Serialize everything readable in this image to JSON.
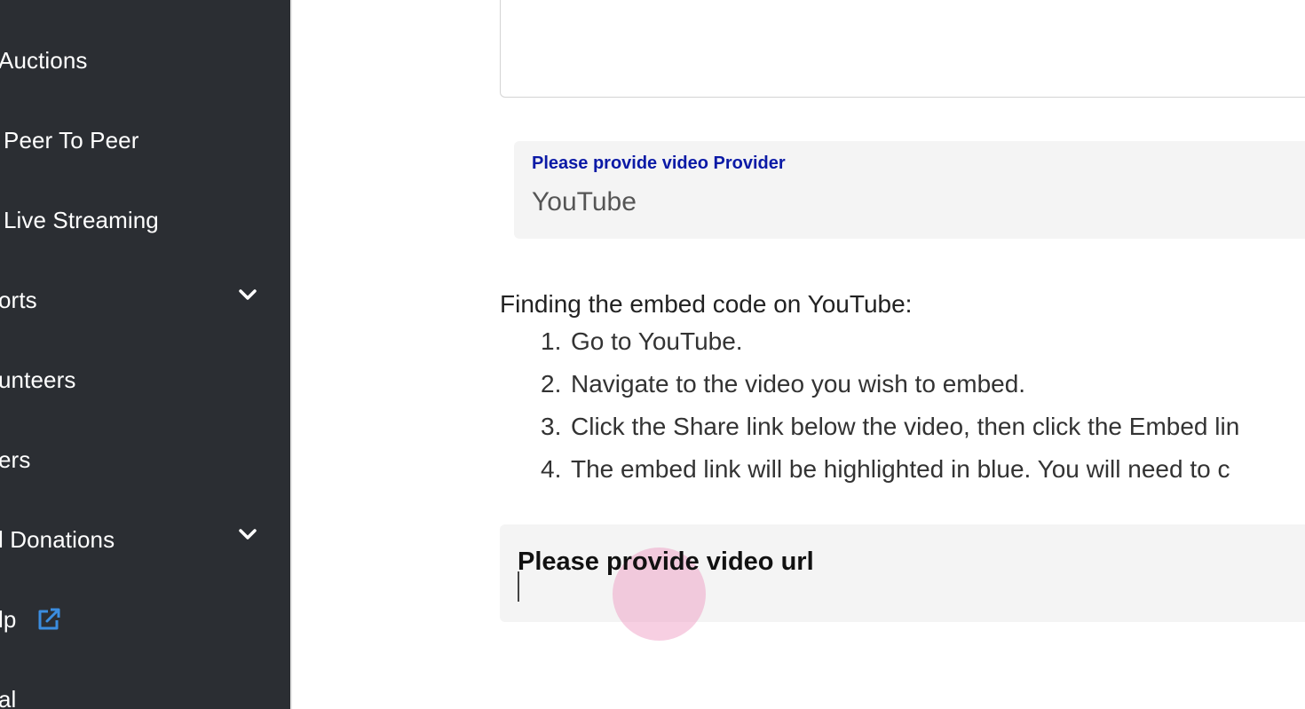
{
  "sidebar": {
    "items": [
      {
        "label": "Auctions"
      },
      {
        "label": "Peer To Peer"
      },
      {
        "label": "Live Streaming"
      },
      {
        "label": "orts"
      },
      {
        "label": "unteers"
      },
      {
        "label": "ers"
      },
      {
        "label": "l Donations"
      },
      {
        "label": "lp"
      },
      {
        "label": "al"
      }
    ]
  },
  "provider": {
    "label": "Please provide video Provider",
    "value": "YouTube"
  },
  "instructions": {
    "title": "Finding the embed code on YouTube:",
    "steps": [
      {
        "num": "1.",
        "text": "Go to YouTube."
      },
      {
        "num": "2.",
        "text": "Navigate to the video you wish to embed."
      },
      {
        "num": "3.",
        "text": "Click the Share link below the video, then click the Embed lin"
      },
      {
        "num": "4.",
        "text": "The embed link will be highlighted in blue. You will need to c"
      }
    ]
  },
  "url_field": {
    "label": "Please provide video url",
    "value": ""
  },
  "colors": {
    "sidebar_bg": "#2b2e33",
    "provider_label": "#0b1aa6",
    "external_link_icon": "#3b8de0"
  }
}
